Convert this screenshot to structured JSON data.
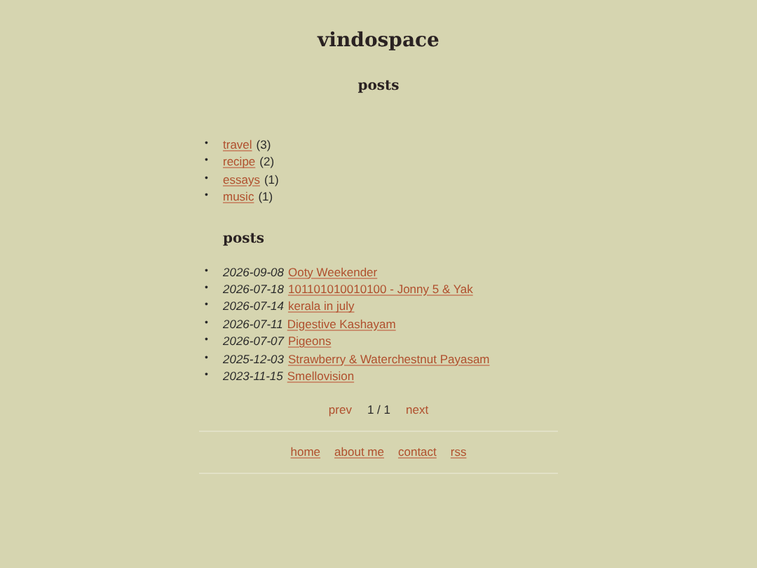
{
  "site_title": "vindospace",
  "page_heading": "posts",
  "tags": [
    {
      "bullet": "•",
      "label": "travel",
      "count": "(3)"
    },
    {
      "bullet": "•",
      "label": "recipe",
      "count": "(2)"
    },
    {
      "bullet": "•",
      "label": "essays",
      "count": "(1)"
    },
    {
      "bullet": "•",
      "label": "music",
      "count": "(1)"
    }
  ],
  "posts_heading": "posts",
  "posts": [
    {
      "bullet": "•",
      "date": "2026-09-08",
      "title": "Ooty Weekender"
    },
    {
      "bullet": "•",
      "date": "2026-07-18",
      "title": "101101010010100 - Jonny 5 & Yak"
    },
    {
      "bullet": "•",
      "date": "2026-07-14",
      "title": "kerala in july"
    },
    {
      "bullet": "•",
      "date": "2026-07-11",
      "title": "Digestive Kashayam"
    },
    {
      "bullet": "•",
      "date": "2026-07-07",
      "title": "Pigeons"
    },
    {
      "bullet": "•",
      "date": "2025-12-03",
      "title": "Strawberry & Waterchestnut Payasam"
    },
    {
      "bullet": "•",
      "date": "2023-11-15",
      "title": "Smellovision"
    }
  ],
  "pager": {
    "prev": "prev",
    "page": "1 / 1",
    "next": "next"
  },
  "footer_links": [
    "home",
    "about me",
    "contact",
    "rss"
  ]
}
